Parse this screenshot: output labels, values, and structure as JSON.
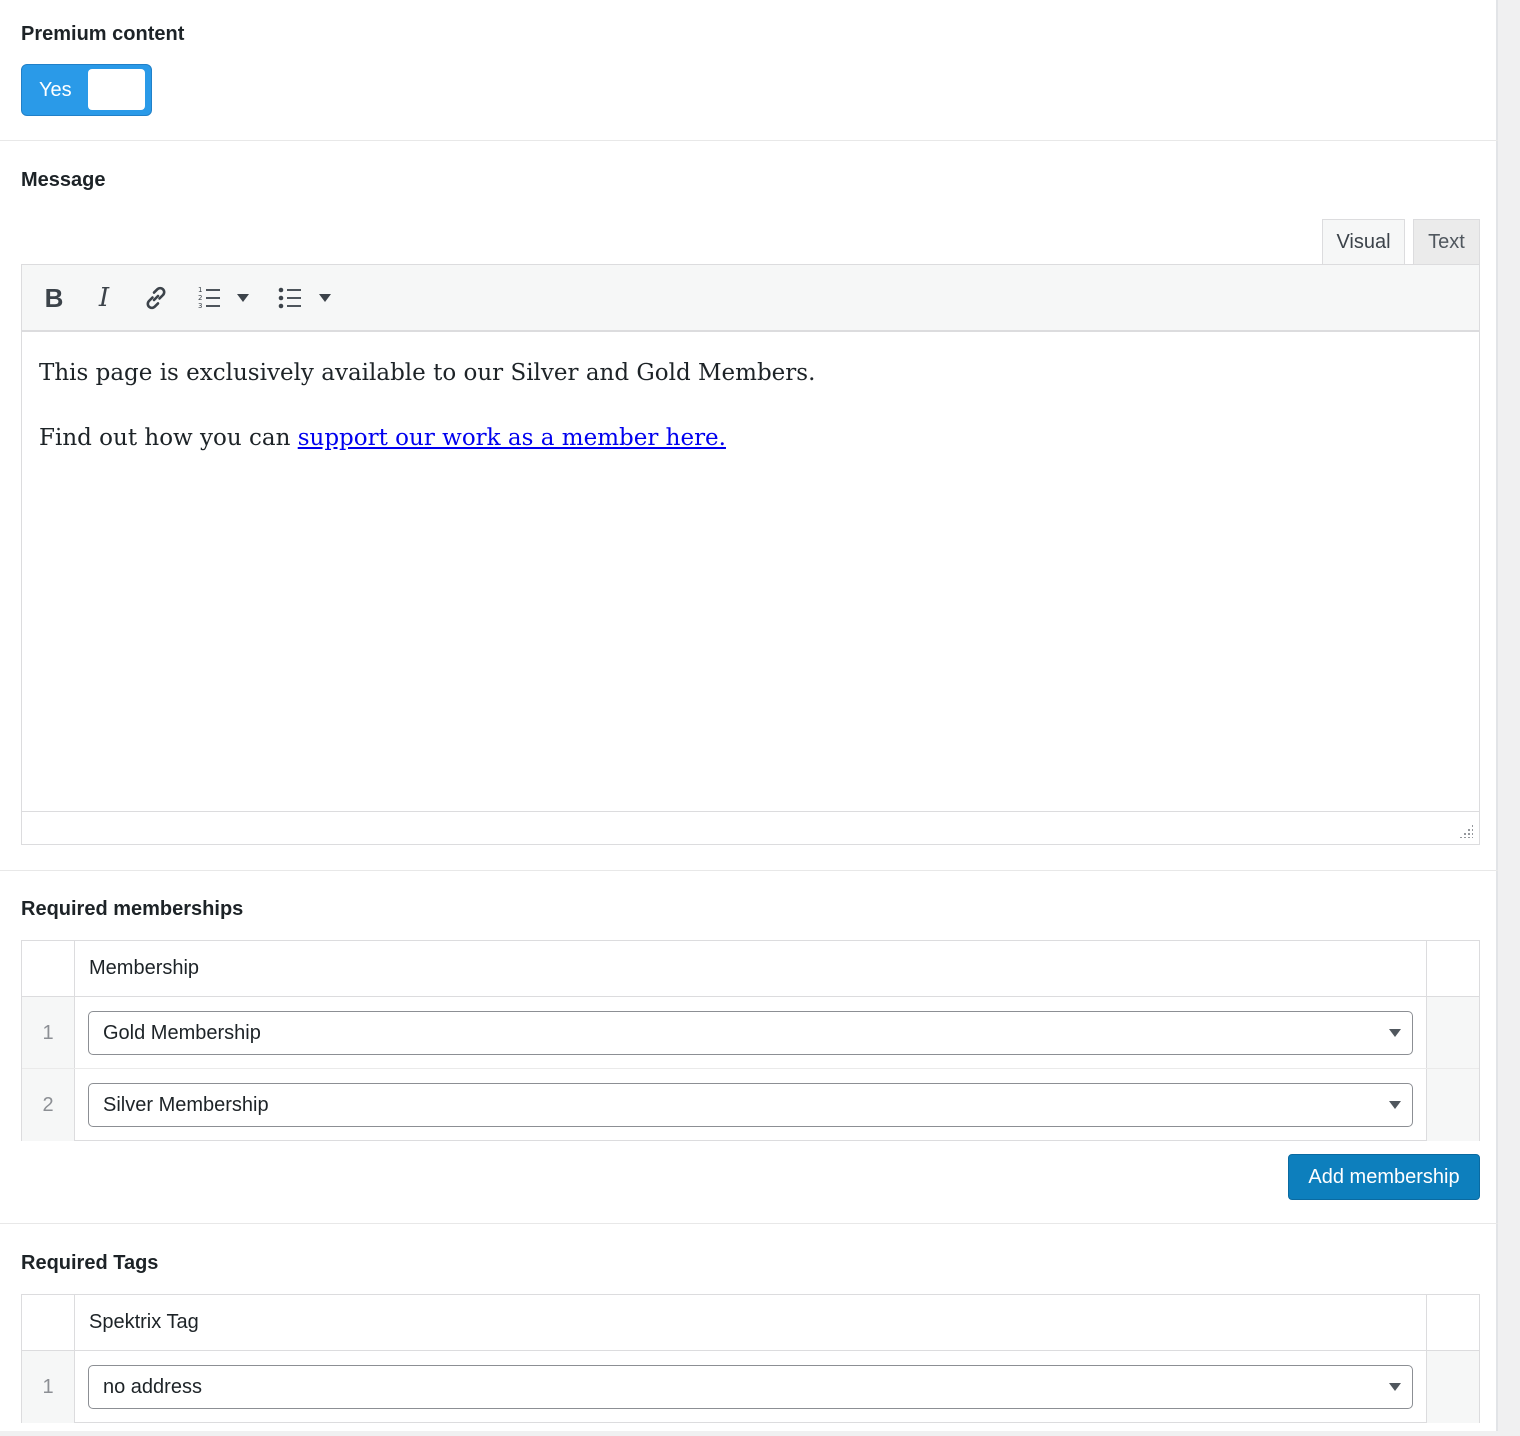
{
  "premium": {
    "label": "Premium content",
    "toggle_label": "Yes"
  },
  "message": {
    "label": "Message",
    "tabs": {
      "visual": "Visual",
      "text": "Text"
    },
    "toolbar": {
      "bold": "B",
      "italic": "I"
    },
    "paragraph1": "This page is exclusively available to our Silver and Gold Members.",
    "paragraph2_prefix": "Find out how you can ",
    "paragraph2_link": "support our work as a member here."
  },
  "memberships": {
    "label": "Required memberships",
    "column": "Membership",
    "rows": [
      {
        "num": "1",
        "value": "Gold Membership"
      },
      {
        "num": "2",
        "value": "Silver Membership"
      }
    ],
    "add_button": "Add membership"
  },
  "tags": {
    "label": "Required Tags",
    "column": "Spektrix Tag",
    "rows": [
      {
        "num": "1",
        "value": "no address"
      }
    ]
  },
  "colors": {
    "accent": "#2a9ae8",
    "button": "#0d7fbd",
    "link": "#0000ee"
  }
}
